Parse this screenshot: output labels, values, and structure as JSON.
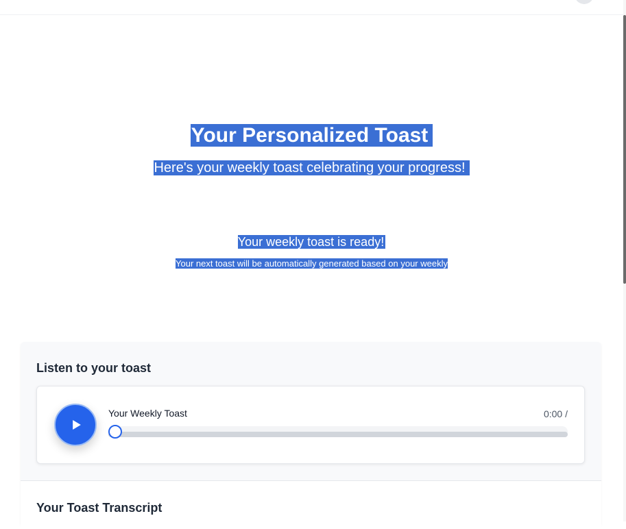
{
  "hero": {
    "title": "Your Personalized Toast",
    "subtitle": "Here's your weekly toast celebrating your progress!"
  },
  "status": {
    "ready_text": "Your weekly toast is ready!",
    "next_text": "Your next toast will be automatically generated based on your weekly"
  },
  "listen": {
    "heading": "Listen to your toast",
    "player": {
      "play_icon": "play-icon",
      "track_title": "Your Weekly Toast",
      "time": "0:00 /",
      "progress": 0
    }
  },
  "transcript": {
    "heading": "Your Toast Transcript"
  },
  "colors": {
    "accent": "#2563eb",
    "selection_highlight": "#3b6fd4"
  }
}
